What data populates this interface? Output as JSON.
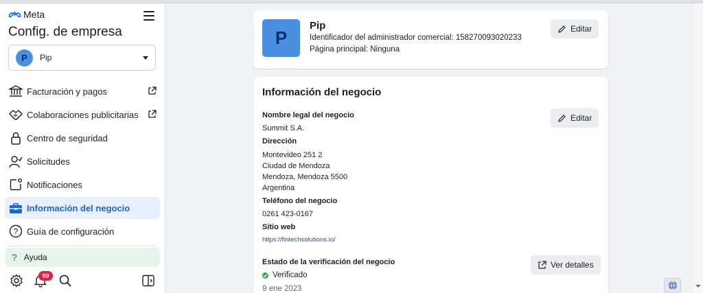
{
  "brand": {
    "name": "Meta",
    "accent": "#1b66c9",
    "logo_icon": "meta-logo-icon"
  },
  "sidebar": {
    "title": "Config. de empresa",
    "account": {
      "avatar_letter": "P",
      "name": "Pip"
    },
    "items": [
      {
        "label": "Facturación y pagos",
        "icon": "bank-icon",
        "external": true
      },
      {
        "label": "Colaboraciones publicitarias",
        "icon": "handshake-icon",
        "external": true
      },
      {
        "label": "Centro de seguridad",
        "icon": "lock-icon",
        "external": false
      },
      {
        "label": "Solicitudes",
        "icon": "person-check-icon",
        "external": false
      },
      {
        "label": "Notificaciones",
        "icon": "notification-icon",
        "external": false
      },
      {
        "label": "Información del negocio",
        "icon": "briefcase-icon",
        "external": false,
        "active": true
      },
      {
        "label": "Guía de configuración",
        "icon": "question-icon",
        "external": false
      }
    ],
    "help_label": "Ayuda",
    "notification_count": "99"
  },
  "profile_card": {
    "avatar_letter": "P",
    "name": "Pip",
    "admin_id_line": "Identificador del administrador comercial: 158270093020233",
    "main_page_line": "Página principal: Ninguna",
    "edit_label": "Editar"
  },
  "business_card": {
    "title": "Información del negocio",
    "edit_label": "Editar",
    "legal_name_label": "Nombre legal del negocio",
    "legal_name": "Summit S.A.",
    "address_label": "Dirección",
    "address_lines": [
      "Montevideo 251 2",
      "Ciudad de Mendoza",
      "Mendoza, Mendoza 5500",
      "Argentina"
    ],
    "phone_label": "Teléfono del negocio",
    "phone": "0261 423-0167",
    "website_label": "Sitio web",
    "website": "https://fintechsolutions.io/",
    "verification_label": "Estado de la verificación del negocio",
    "verification_status": "Verificado",
    "verification_date": "9 ene 2023",
    "details_label": "Ver detalles"
  }
}
